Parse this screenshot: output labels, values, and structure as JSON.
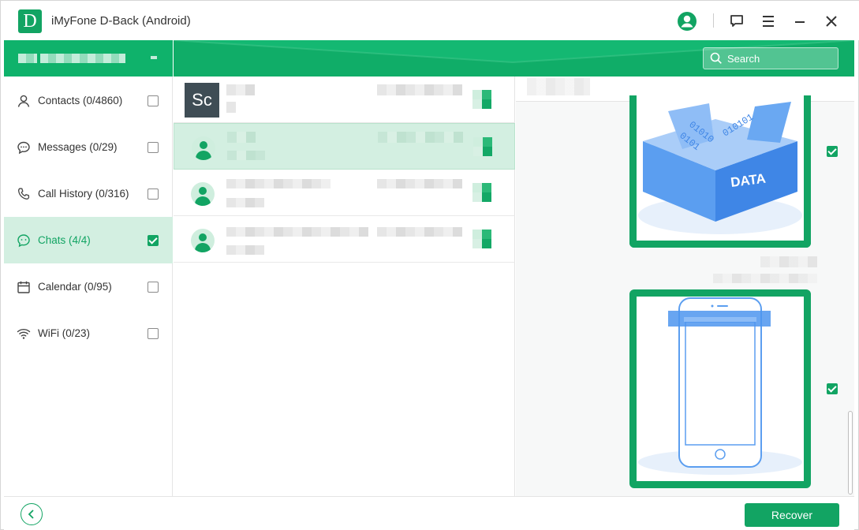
{
  "window": {
    "logo_letter": "D",
    "title": "iMyFone D-Back (Android)",
    "icons": [
      "user-account-icon",
      "feedback-icon",
      "menu-icon",
      "minimize-icon",
      "close-icon"
    ]
  },
  "header": {
    "search_placeholder": "Search"
  },
  "sidebar": {
    "items": [
      {
        "label": "Contacts (0/4860)",
        "icon": "contact-icon",
        "checked": false,
        "active": false
      },
      {
        "label": "Messages (0/29)",
        "icon": "message-icon",
        "checked": false,
        "active": false
      },
      {
        "label": "Call History (0/316)",
        "icon": "phone-icon",
        "checked": false,
        "active": false
      },
      {
        "label": "Chats (4/4)",
        "icon": "chat-icon",
        "checked": true,
        "active": true
      },
      {
        "label": "Calendar (0/95)",
        "icon": "calendar-icon",
        "checked": false,
        "active": false
      },
      {
        "label": "WiFi (0/23)",
        "icon": "wifi-icon",
        "checked": false,
        "active": false
      }
    ]
  },
  "chats": {
    "rows": [
      {
        "avatar_text": "Sc",
        "selected": false
      },
      {
        "avatar_text": "",
        "selected": true
      },
      {
        "avatar_text": "",
        "selected": false
      },
      {
        "avatar_text": "",
        "selected": false
      }
    ]
  },
  "preview": {
    "images": [
      {
        "name": "data-box-image",
        "label": "DATA",
        "checked": true
      },
      {
        "name": "phone-image",
        "checked": true
      }
    ]
  },
  "footer": {
    "recover_label": "Recover"
  },
  "colors": {
    "accent": "#12a463",
    "active_bg": "#d3efe1"
  }
}
